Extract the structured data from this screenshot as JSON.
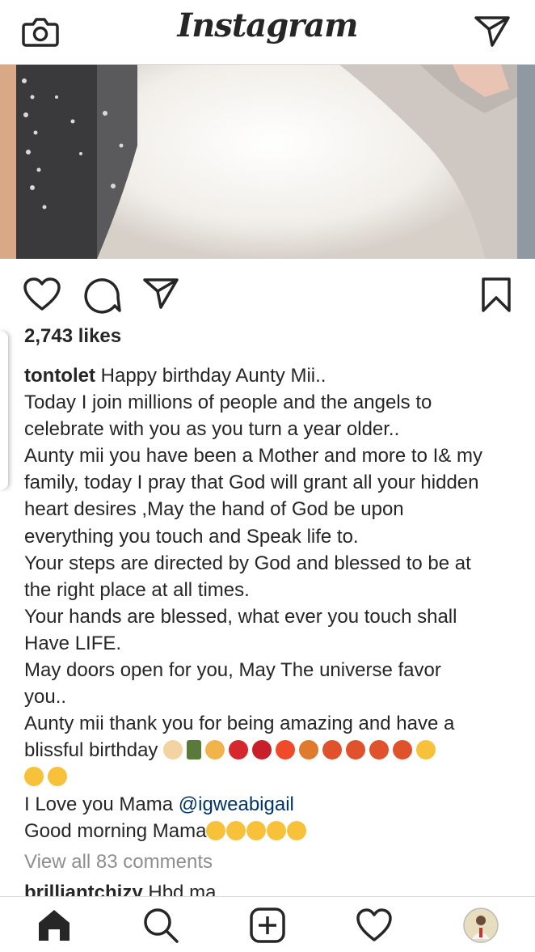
{
  "header": {
    "logo_text": "Instagram",
    "camera_icon": "camera-icon",
    "direct_icon": "paper-plane-icon"
  },
  "post": {
    "photo_description_icon": "photo",
    "actions": {
      "like_icon": "heart-outline-icon",
      "comment_icon": "comment-icon",
      "share_icon": "paper-plane-icon",
      "save_icon": "bookmark-icon"
    },
    "likes": "2,743 likes",
    "username": "tontolet",
    "caption_lines": [
      "Happy birthday Aunty Mii..",
      "Today I join millions of people and the angels to",
      "celebrate with you as you turn a year older..",
      "Aunty mii you have been a Mother and more to I& my",
      "family, today I pray that God will grant all your hidden",
      "heart desires ,May the hand of God be upon",
      "everything you touch and Speak life to.",
      "Your steps are directed by God and blessed to be at",
      "the right place at all times.",
      "Your hands are blessed, what ever you touch shall",
      "Have LIFE.",
      "May doors open for you, May The universe favor",
      "you..",
      "Aunty mii thank you for being amazing and have a",
      "blissful birthday"
    ],
    "love_text": "I Love you Mama",
    "mention": "@igweabigail",
    "morning_text": "Good morning Mama",
    "view_all": "View all 83 comments",
    "next_comment_user": "brilliantchizy",
    "next_comment_text": "Hbd ma"
  },
  "nav": {
    "home_icon": "home-icon",
    "search_icon": "search-icon",
    "add_icon": "add-post-icon",
    "activity_icon": "heart-outline-icon",
    "profile_icon": "avatar"
  },
  "colors": {
    "text": "#262626",
    "muted": "#8e8e8e",
    "mention": "#003569",
    "divider": "#dbdbdb"
  }
}
